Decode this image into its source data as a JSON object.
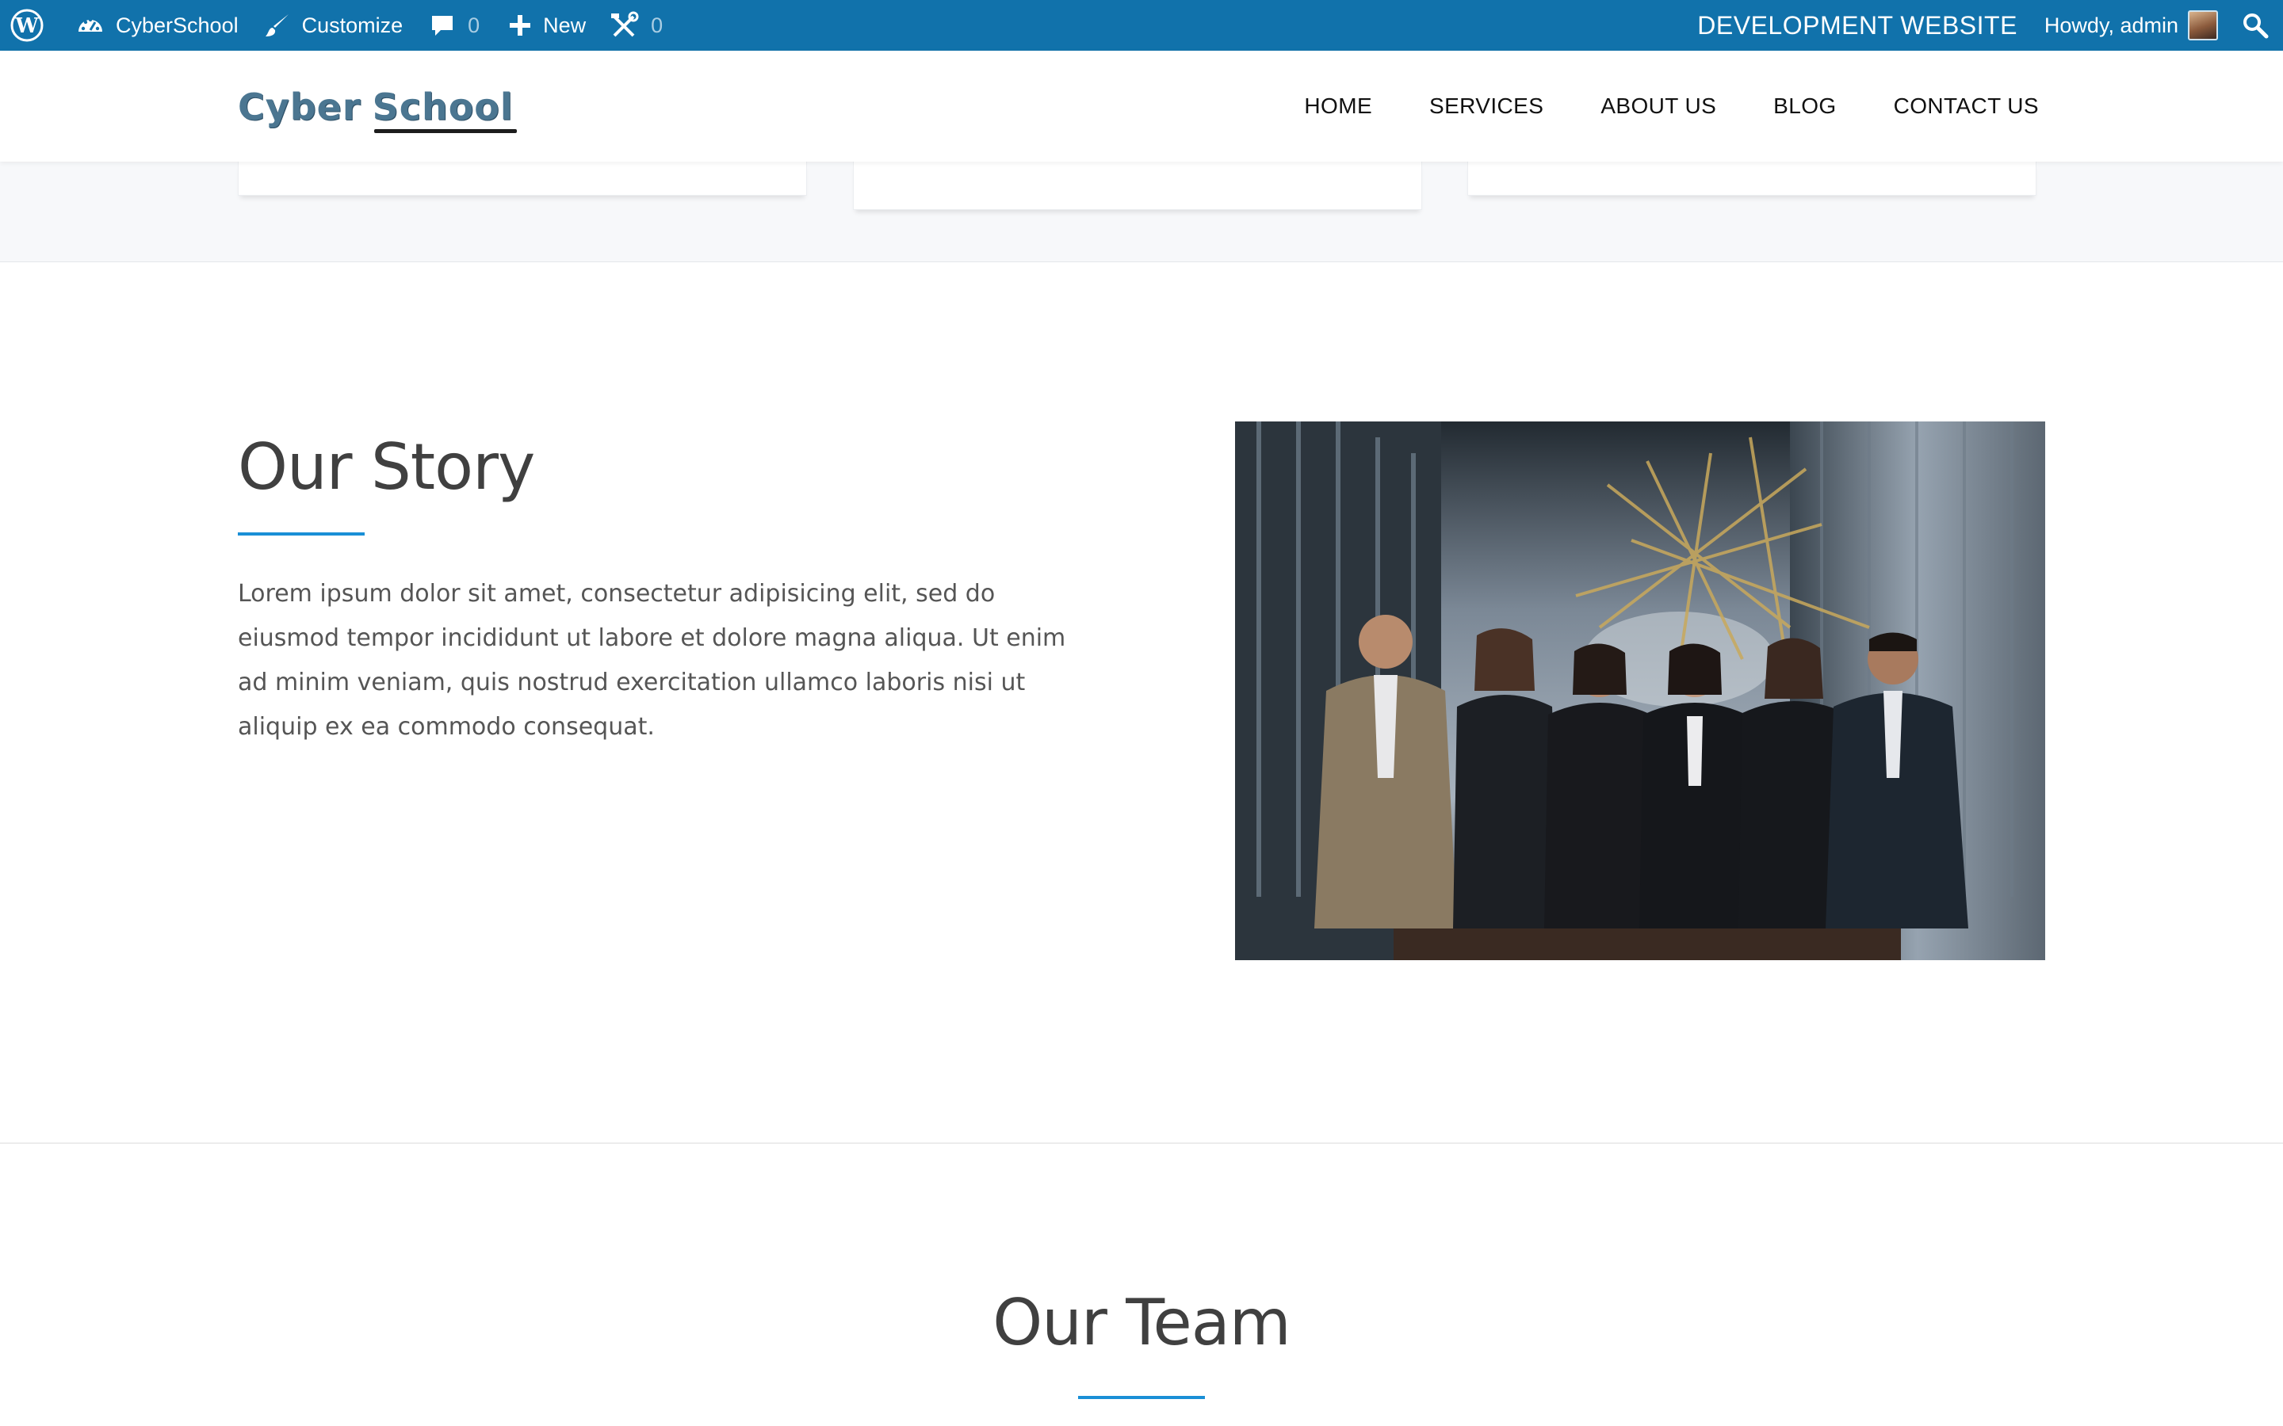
{
  "admin_bar": {
    "site_name": "CyberSchool",
    "customize": "Customize",
    "comments_count": "0",
    "new_label": "New",
    "updates_count": "0",
    "dev_label": "DEVELOPMENT WEBSITE",
    "greeting": "Howdy, admin",
    "icons": [
      "wordpress-icon",
      "dashboard-icon",
      "brush-icon",
      "comment-icon",
      "plus-icon",
      "tools-icon",
      "search-icon"
    ],
    "color": "#1172ab"
  },
  "header": {
    "logo_part1": "Cyber",
    "logo_part2": "School",
    "nav": [
      "HOME",
      "SERVICES",
      "ABOUT US",
      "BLOG",
      "CONTACT US"
    ]
  },
  "story": {
    "title": "Our Story",
    "text": "Lorem ipsum dolor sit amet, consectetur adipisicing elit, sed do eiusmod tempor incididunt ut labore et dolore magna aliqua. Ut enim ad minim veniam, quis nostrud exercitation ullamco laboris nisi ut aliquip ex ea commodo consequat."
  },
  "team": {
    "title": "Our Team"
  },
  "accent_color": "#1a8fd6"
}
